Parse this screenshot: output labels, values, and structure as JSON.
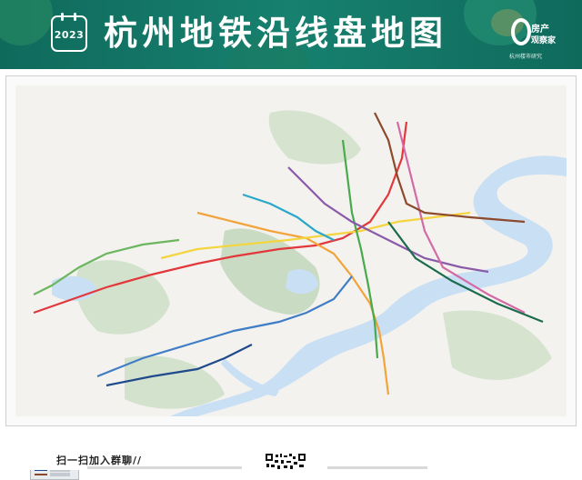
{
  "header": {
    "year_badge": "2023",
    "title": "杭州地铁沿线盘地图",
    "brand_mark": "O",
    "brand_line1": "房产",
    "brand_line2": "观察家",
    "brand_tagline": "杭州楼市研究"
  },
  "map": {
    "colors": {
      "river": "#c9dff4",
      "green": "#c9dcc3",
      "lake": "#c9dff4"
    },
    "lines": [
      {
        "color": "#e2373b"
      },
      {
        "color": "#f2a33a"
      },
      {
        "color": "#f4d53f"
      },
      {
        "color": "#49a94d"
      },
      {
        "color": "#8a5aa8"
      },
      {
        "color": "#3f7dc6"
      },
      {
        "color": "#d26aa6"
      },
      {
        "color": "#1f4a8c"
      },
      {
        "color": "#8b4a2c"
      },
      {
        "color": "#2aa7c9"
      },
      {
        "color": "#6cb65f"
      },
      {
        "color": "#1c6b4f"
      }
    ]
  },
  "footer": {
    "scan_text": "扫一扫加入群聊//"
  }
}
